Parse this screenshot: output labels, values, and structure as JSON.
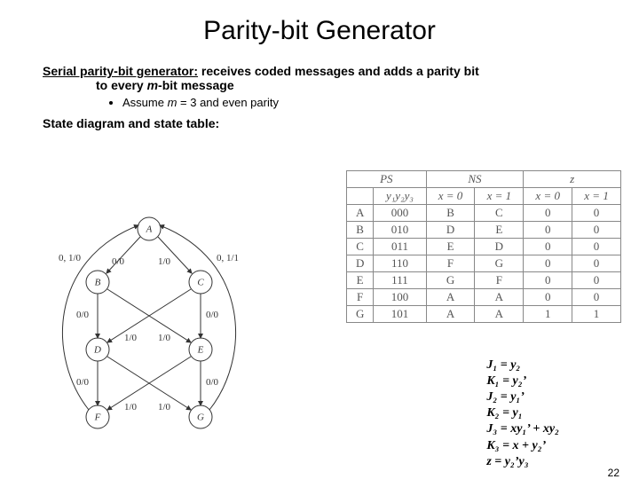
{
  "title": "Parity-bit Generator",
  "intro": {
    "heading": "Serial parity-bit generator:",
    "rest": " receives coded messages and adds a parity bit",
    "line2_prefix": "to every ",
    "line2_em": "m",
    "line2_suffix": "-bit message",
    "bullet_prefix": "Assume ",
    "bullet_em": "m",
    "bullet_suffix": " = 3 and even parity"
  },
  "sd_title": "State diagram and state table:",
  "diagram": {
    "states": [
      "A",
      "B",
      "C",
      "D",
      "E",
      "F",
      "G"
    ],
    "edge_labels": {
      "leftA": "0, 1/0",
      "AB": "0/0",
      "AC": "1/0",
      "rightA": "0, 1/1",
      "BD": "0/0",
      "BE": "1/0",
      "CD": "1/0",
      "CE": "0/0",
      "DF": "0/0",
      "DG": "1/0",
      "EF": "1/0",
      "EG": "0/0"
    }
  },
  "table": {
    "headers": {
      "ps": "PS",
      "ns": "NS",
      "z": "z",
      "x0": "x = 0",
      "x1": "x = 1"
    },
    "code_header": "y₁y₂y₃",
    "rows": [
      {
        "ps": "A",
        "code": "000",
        "ns0": "B",
        "ns1": "C",
        "z0": "0",
        "z1": "0"
      },
      {
        "ps": "B",
        "code": "010",
        "ns0": "D",
        "ns1": "E",
        "z0": "0",
        "z1": "0"
      },
      {
        "ps": "C",
        "code": "011",
        "ns0": "E",
        "ns1": "D",
        "z0": "0",
        "z1": "0"
      },
      {
        "ps": "D",
        "code": "110",
        "ns0": "F",
        "ns1": "G",
        "z0": "0",
        "z1": "0"
      },
      {
        "ps": "E",
        "code": "111",
        "ns0": "G",
        "ns1": "F",
        "z0": "0",
        "z1": "0"
      },
      {
        "ps": "F",
        "code": "100",
        "ns0": "A",
        "ns1": "A",
        "z0": "0",
        "z1": "0"
      },
      {
        "ps": "G",
        "code": "101",
        "ns0": "A",
        "ns1": "A",
        "z0": "1",
        "z1": "1"
      }
    ]
  },
  "equations": {
    "J1": "J₁ = y₂",
    "K1": "K₁ = y₂’",
    "J2": "J₂ = y₁’",
    "K2": "K₂ = y₁",
    "J3": "J₃ = xy₁’ + xy₂",
    "K3": "K₃ = x + y₂’",
    "z": "  z  = y₂’y₃"
  },
  "page": "22"
}
